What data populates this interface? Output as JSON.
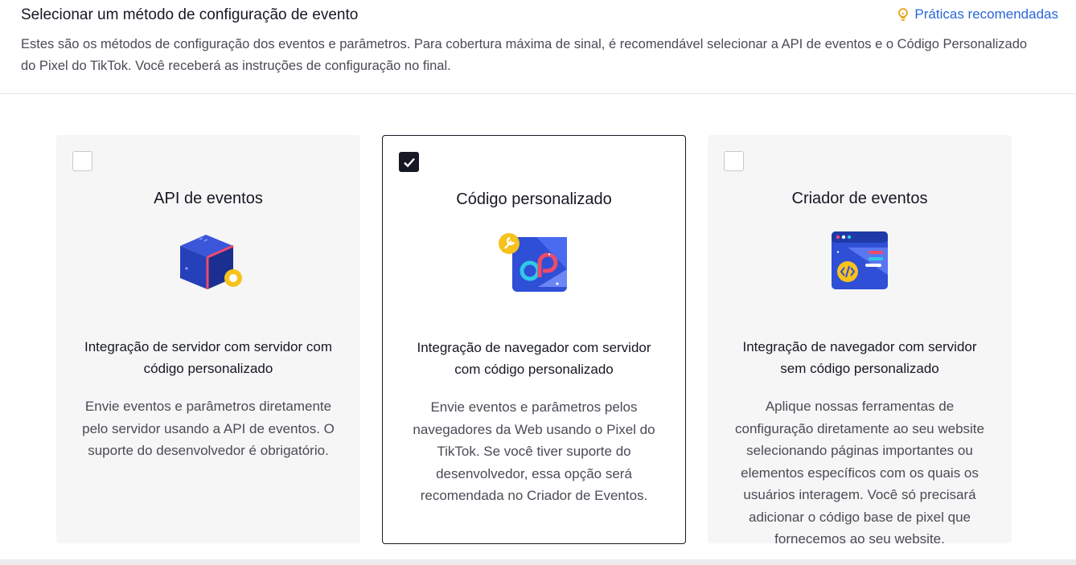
{
  "header": {
    "title": "Selecionar um método de configuração de evento",
    "best_practices": "Práticas recomendadas",
    "subtitle": "Estes são os métodos de configuração dos eventos e parâmetros. Para cobertura máxima de sinal, é recomendável selecionar a API de eventos e o Código Personalizado do Pixel do TikTok. Você receberá as instruções de configuração no final."
  },
  "cards": [
    {
      "title": "API de eventos",
      "icon": "events-api-cube-icon",
      "selected": false,
      "subtitle": "Integração de servidor com servidor com código personalizado",
      "description": "Envie eventos e parâmetros diretamente pelo servidor usando a API de eventos. O suporte do desenvolvedor é obrigatório."
    },
    {
      "title": "Código personalizado",
      "icon": "custom-code-icon",
      "selected": true,
      "subtitle": "Integração de navegador com servidor com código personalizado",
      "description": "Envie eventos e parâmetros pelos navegadores da Web usando o Pixel do TikTok. Se você tiver suporte do desenvolvedor, essa opção será recomendada no Criador de Eventos."
    },
    {
      "title": "Criador de eventos",
      "icon": "event-builder-icon",
      "selected": false,
      "subtitle": "Integração de navegador com servidor sem código personalizado",
      "description": "Aplique nossas ferramentas de configuração diretamente ao seu website selecionando páginas importantes ou elementos específicos com os quais os usuários interagem. Você só precisará adicionar o código base de pixel que fornecemos ao seu website."
    }
  ],
  "colors": {
    "link": "#2a66d9",
    "card_bg": "#f6f6f6",
    "selected_border": "#161823"
  }
}
